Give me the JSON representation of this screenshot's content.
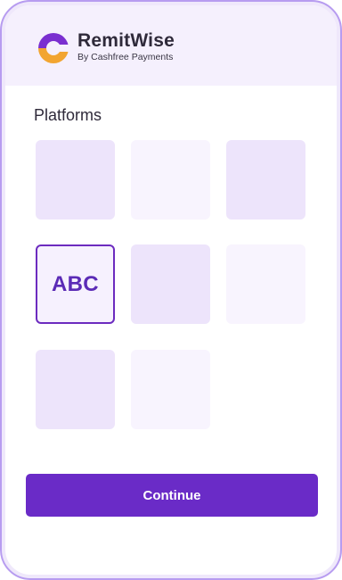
{
  "brand": {
    "name": "RemitWise",
    "tagline": "By Cashfree Payments",
    "logo_icon": "remitwise-logo-icon"
  },
  "section": {
    "title": "Platforms"
  },
  "platforms": [
    {
      "label": "",
      "selected": false
    },
    {
      "label": "",
      "selected": false
    },
    {
      "label": "",
      "selected": false
    },
    {
      "label": "ABC",
      "selected": true
    },
    {
      "label": "",
      "selected": false
    },
    {
      "label": "",
      "selected": false
    },
    {
      "label": "",
      "selected": false
    },
    {
      "label": "",
      "selected": false
    }
  ],
  "actions": {
    "continue_label": "Continue"
  },
  "colors": {
    "accent": "#6a2bc7",
    "frame": "#b79cf0",
    "header_bg": "#f5f0fd",
    "tile_dark": "#ede4fb",
    "tile_light": "#f8f4fe"
  }
}
